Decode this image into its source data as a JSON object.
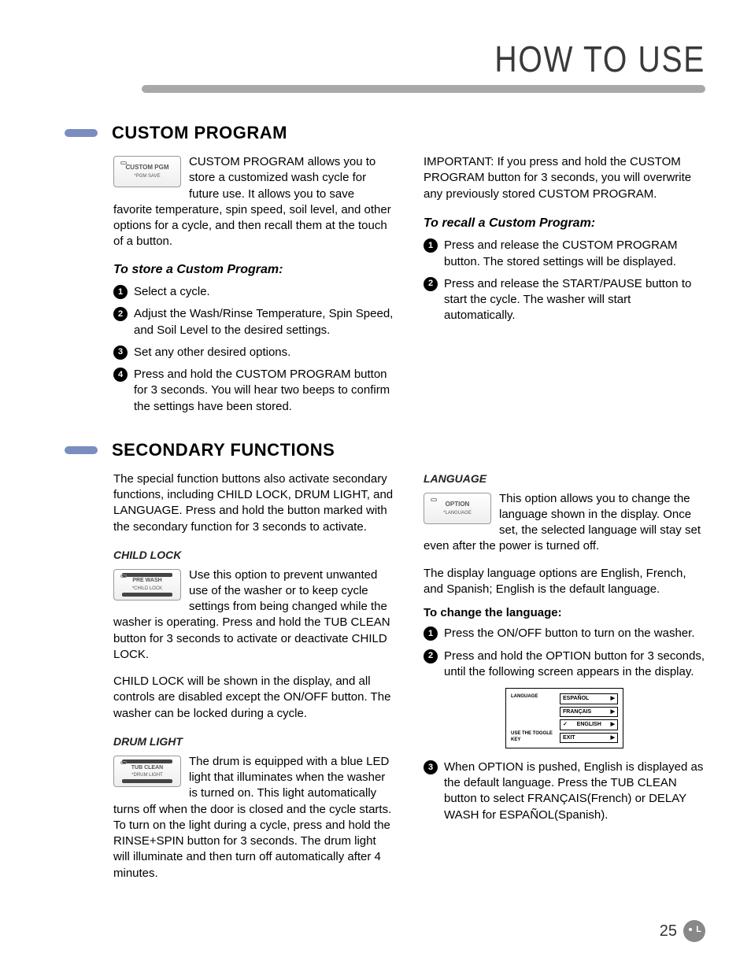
{
  "page": {
    "title": "HOW TO USE",
    "number": "25"
  },
  "custom_program": {
    "heading": "CUSTOM PROGRAM",
    "button": {
      "label": "CUSTOM PGM",
      "sub": "*PGM SAVE"
    },
    "intro": "CUSTOM PROGRAM allows you to store a customized wash cycle for future use. It allows you to save favorite temperature, spin speed, soil level, and other options for a cycle, and then recall them at the touch of a button.",
    "store_heading": "To store a Custom Program:",
    "store_steps": [
      "Select a cycle.",
      "Adjust the Wash/Rinse Temperature, Spin Speed, and Soil Level to the desired settings.",
      "Set any other desired options.",
      "Press and hold the CUSTOM PROGRAM button for 3 seconds. You will hear two beeps to confirm the settings have been stored."
    ],
    "important": "IMPORTANT: If you press and hold the CUSTOM PROGRAM button for 3 seconds, you will overwrite any previously stored CUSTOM PROGRAM.",
    "recall_heading": "To recall a Custom Program:",
    "recall_steps": [
      "Press and release the CUSTOM PROGRAM button. The stored settings will be displayed.",
      "Press and release the START/PAUSE button to start the cycle. The washer will start automatically."
    ]
  },
  "secondary": {
    "heading": "SECONDARY FUNCTIONS",
    "intro": "The special function buttons also activate secondary functions, including CHILD LOCK, DRUM LIGHT, and LANGUAGE. Press and hold the button marked with the secondary function for 3 seconds to activate.",
    "child_lock": {
      "heading": "CHILD LOCK",
      "button": {
        "label": "PRE WASH",
        "sub": "*CHILD LOCK"
      },
      "p1": "Use this option to prevent unwanted use of the washer or to keep cycle settings from being changed while the washer is operating. Press and hold the TUB CLEAN button for 3 seconds to activate or deactivate CHILD LOCK.",
      "p2": "CHILD LOCK will be shown in the display, and all controls are disabled except the ON/OFF button. The washer can be locked during a cycle."
    },
    "drum_light": {
      "heading": "DRUM LIGHT",
      "button": {
        "label": "TUB CLEAN",
        "sub": "*DRUM LIGHT"
      },
      "p1": "The drum is equipped with a blue LED light that illuminates when the washer is turned on. This light automatically turns off when the door is closed and the cycle starts. To turn on the light during a cycle, press and hold the RINSE+SPIN button for 3 seconds. The drum light will illuminate and then turn off automatically after 4 minutes."
    },
    "language": {
      "heading": "LANGUAGE",
      "button": {
        "label": "OPTION",
        "sub": "*LANGUAGE"
      },
      "intro": "This option allows you to change the language shown in the display. Once set, the selected language will stay set even after the power is turned off.",
      "options_line": "The display language options are English, French, and Spanish; English is the default language.",
      "change_heading": "To change the language:",
      "steps": [
        "Press the ON/OFF button to turn on the washer.",
        "Press and hold the OPTION button for 3 seconds, until the following screen appears in the display.",
        "When OPTION is pushed, English is displayed as the default language. Press the TUB CLEAN button to select FRANÇAIS(French) or DELAY WASH for ESPAÑOL(Spanish)."
      ],
      "screen": {
        "left_top": "LANGUAGE",
        "left_bottom": "USE THE TOGGLE KEY",
        "options": [
          "ESPAÑOL",
          "FRANÇAIS",
          "ENGLISH",
          "EXIT"
        ],
        "selected_index": 2
      }
    }
  }
}
